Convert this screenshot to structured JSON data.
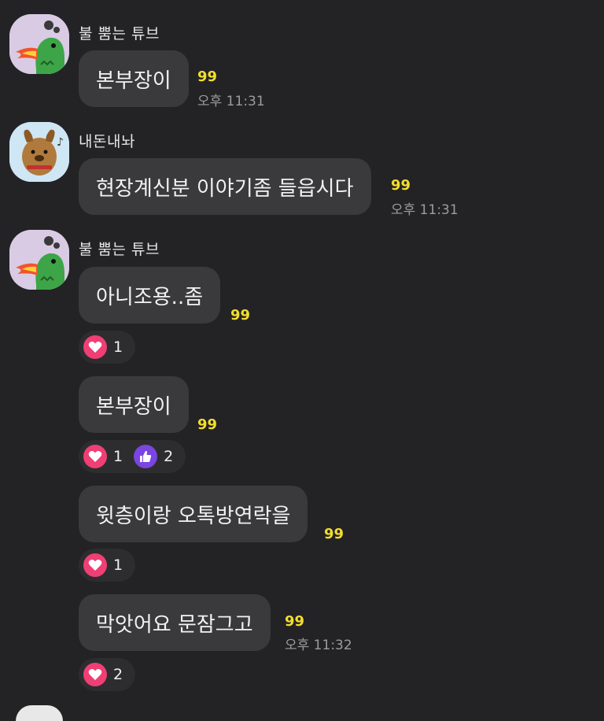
{
  "colors": {
    "background": "#232325",
    "bubble": "#3a3a3c",
    "unread": "#f3dd2c",
    "heart": "#ef3f75",
    "thumbs_up": "#7a45e0"
  },
  "messages": [
    {
      "sender": "불 뿜는 튜브",
      "avatar_icon": "fire-breathing-tube-icon",
      "text": "본부장이",
      "unread": "99",
      "time": "오후 11:31"
    },
    {
      "sender": "내돈내놔",
      "avatar_icon": "muzi-dog-icon",
      "text": "현장계신분 이야기좀 들읍시다",
      "unread": "99",
      "time": "오후 11:31"
    },
    {
      "sender": "불 뿜는 튜브",
      "avatar_icon": "fire-breathing-tube-icon",
      "text": "아니조용..좀",
      "unread": "99",
      "reactions": [
        {
          "icon": "heart-icon",
          "count": "1"
        }
      ]
    },
    {
      "text": "본부장이",
      "unread": "99",
      "reactions": [
        {
          "icon": "heart-icon",
          "count": "1"
        },
        {
          "icon": "thumbs-up-icon",
          "count": "2"
        }
      ]
    },
    {
      "text": "윗층이랑 오톡방연락을",
      "unread": "99",
      "reactions": [
        {
          "icon": "heart-icon",
          "count": "1"
        }
      ]
    },
    {
      "text": "막앗어요 문잠그고",
      "unread": "99",
      "time": "오후 11:32",
      "reactions": [
        {
          "icon": "heart-icon",
          "count": "2"
        }
      ]
    }
  ]
}
